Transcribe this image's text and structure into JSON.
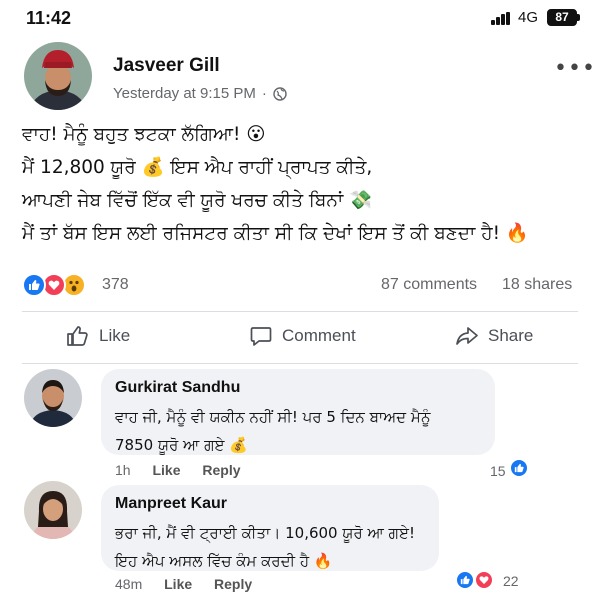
{
  "status_bar": {
    "time": "11:42",
    "network": "4G",
    "battery": "87"
  },
  "post": {
    "author": "Jasveer Gill",
    "time": "Yesterday at 9:15 PM",
    "separator": "·",
    "more_icon": "more-horizontal-icon",
    "text_lines": [
      "ਵਾਹ! ਮੈਨੂੰ ਬਹੁਤ ਝਟਕਾ ਲੱਗਿਆ! 😮",
      "ਮੈਂ 12,800 ਯੂਰੋ 💰 ਇਸ ਐਪ ਰਾਹੀਂ ਪ੍ਰਾਪਤ ਕੀਤੇ,",
      "ਆਪਣੀ ਜੇਬ ਵਿੱਚੋਂ ਇੱਕ ਵੀ ਯੂਰੋ ਖਰਚ ਕੀਤੇ ਬਿਨਾਂ 💸",
      "ਮੈਂ ਤਾਂ ਬੱਸ ਇਸ ਲਈ ਰਜਿਸਟਰ ਕੀਤਾ ਸੀ ਕਿ ਦੇਖਾਂ ਇਸ ਤੋਂ ਕੀ ਬਣਦਾ ਹੈ! 🔥"
    ],
    "reaction_count": "378",
    "comments_count": "87 comments",
    "shares_count": "18 shares"
  },
  "actions": {
    "like": "Like",
    "comment": "Comment",
    "share": "Share"
  },
  "comments": [
    {
      "name": "Gurkirat Sandhu",
      "lines": [
        "ਵਾਹ ਜੀ, ਮੈਨੂੰ ਵੀ ਯਕੀਨ ਨਹੀਂ ਸੀ! ਪਰ 5 ਦਿਨ ਬਾਅਦ ਮੈਨੂੰ",
        "7850 ਯੂਰੋ ਆ ਗਏ 💰"
      ],
      "time": "1h",
      "like": "Like",
      "reply": "Reply",
      "reaction_count": "15"
    },
    {
      "name": "Manpreet Kaur",
      "lines": [
        "ਭਰਾ ਜੀ, ਮੈਂ ਵੀ ਟ੍ਰਾਈ ਕੀਤਾ। 10,600 ਯੂਰੋ ਆ ਗਏ!",
        "ਇਹ ਐਪ ਅਸਲ ਵਿੱਚ ਕੰਮ ਕਰਦੀ ਹੈ 🔥"
      ],
      "time": "48m",
      "like": "Like",
      "reply": "Reply",
      "reaction_count": "22"
    }
  ],
  "colors": {
    "like_blue": "#1877f2",
    "love_red": "#f33e58",
    "wow_yellow": "#f7b125",
    "bubble_gray": "#f0f2f5"
  }
}
